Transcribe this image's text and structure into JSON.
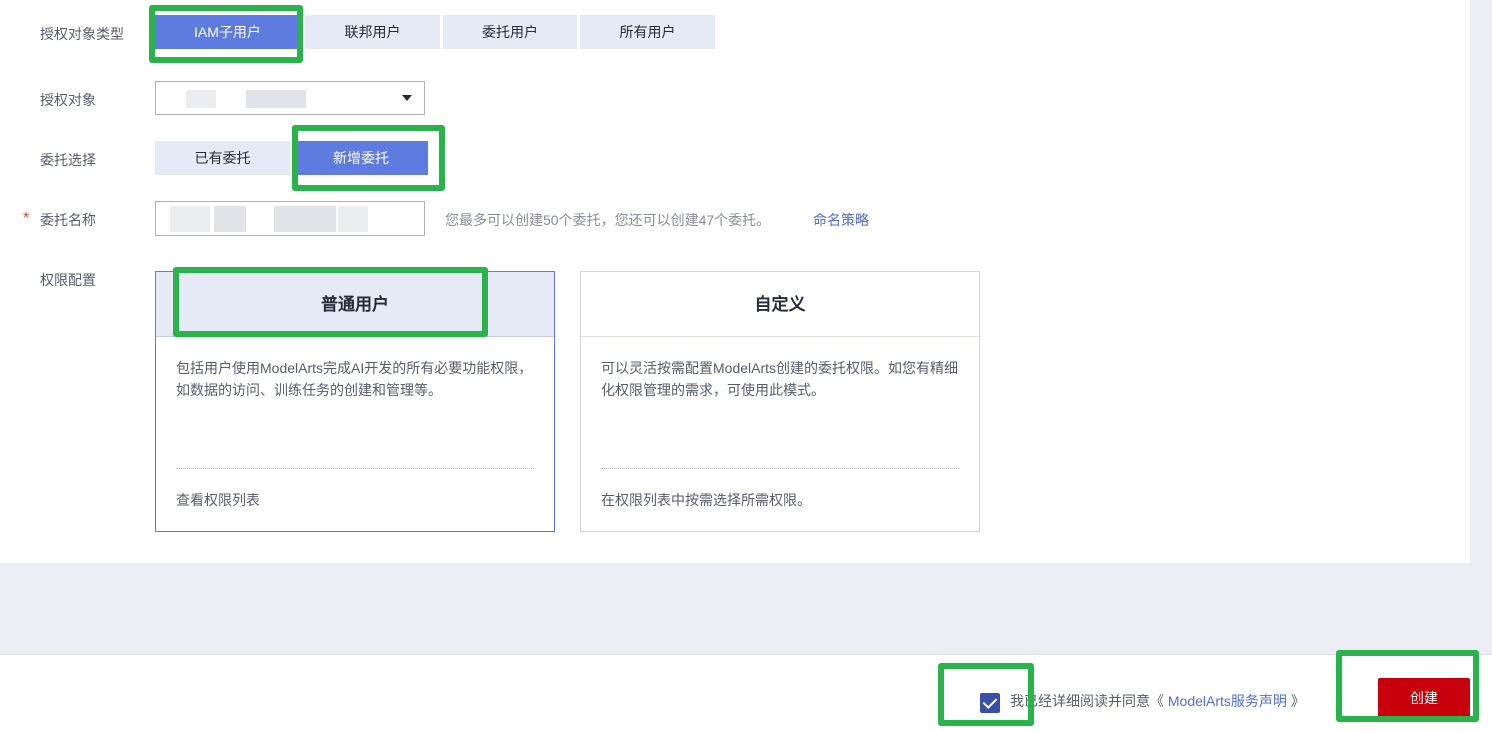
{
  "form": {
    "auth_type_label": "授权对象类型",
    "auth_type_options": [
      "IAM子用户",
      "联邦用户",
      "委托用户",
      "所有用户"
    ],
    "auth_target_label": "授权对象",
    "delegation_choice_label": "委托选择",
    "delegation_choice_options": [
      "已有委托",
      "新增委托"
    ],
    "delegation_name_label": "委托名称",
    "required_mark": "*",
    "delegation_hint": "您最多可以创建50个委托，您还可以创建47个委托。",
    "naming_policy_link": "命名策略",
    "permission_label": "权限配置"
  },
  "cards": [
    {
      "title": "普通用户",
      "desc": "包括用户使用ModelArts完成AI开发的所有必要功能权限，如数据的访问、训练任务的创建和管理等。",
      "foot": "查看权限列表"
    },
    {
      "title": "自定义",
      "desc": "可以灵活按需配置ModelArts创建的委托权限。如您有精细化权限管理的需求，可使用此模式。",
      "foot": "在权限列表中按需选择所需权限。"
    }
  ],
  "footer": {
    "agree_prefix": "我已经详细阅读并同意《",
    "agree_link": "ModelArts服务声明",
    "agree_suffix": "》",
    "create_label": "创建"
  },
  "colors": {
    "accent": "#5e7ce0",
    "highlight": "#2ab34a",
    "create": "#c7000b"
  }
}
